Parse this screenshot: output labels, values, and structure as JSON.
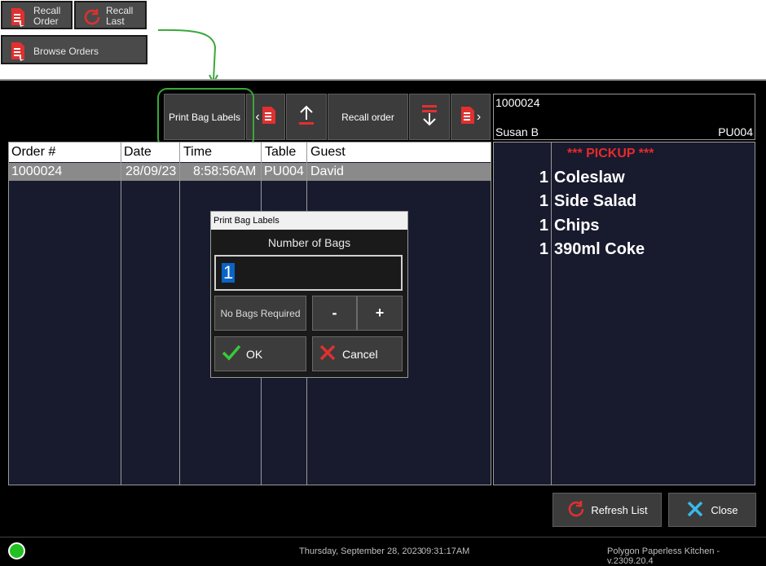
{
  "legend": {
    "recall_order": [
      "Recall",
      "Order"
    ],
    "recall_last": [
      "Recall",
      "Last"
    ],
    "browse_orders": "Browse Orders"
  },
  "toolbar": {
    "print_bag_labels": "Print Bag Labels",
    "recall_order": "Recall order"
  },
  "order_info": {
    "number": "1000024",
    "server": "Susan B",
    "table": "PU004"
  },
  "table": {
    "headers": [
      "Order #",
      "Date",
      "Time",
      "Table",
      "Guest"
    ],
    "rows": [
      [
        "1000024",
        "28/09/23",
        "8:58:56AM",
        "PU004",
        "David"
      ]
    ]
  },
  "ticket": {
    "header": "*** PICKUP ***",
    "items": [
      {
        "qty": "1",
        "name": "Coleslaw"
      },
      {
        "qty": "1",
        "name": "Side Salad"
      },
      {
        "qty": "1",
        "name": "Chips"
      },
      {
        "qty": "1",
        "name": "390ml Coke"
      }
    ]
  },
  "dialog": {
    "title": "Print Bag Labels",
    "label": "Number of Bags",
    "value": "1",
    "no_bags": "No Bags Required",
    "minus": "-",
    "plus": "+",
    "ok": "OK",
    "cancel": "Cancel"
  },
  "footer": {
    "refresh": "Refresh List",
    "close": "Close",
    "date": "Thursday, September 28, 2023",
    "time": "09:31:17AM",
    "version": "Polygon Paperless Kitchen - v.2309.20.4"
  },
  "colors": {
    "app_bg": "#000000",
    "panel_bg": "#181a2e",
    "selected_row": "#8a8a8a",
    "pickup_red": "#e52b2b",
    "annotation_green": "#3aa83a",
    "status_green": "#22c022"
  },
  "icons": {
    "document": "document-icon",
    "arrow_up": "arrow-up-icon",
    "arrow_down": "arrow-down-icon",
    "refresh": "refresh-icon",
    "check": "check-icon",
    "close": "close-icon"
  }
}
